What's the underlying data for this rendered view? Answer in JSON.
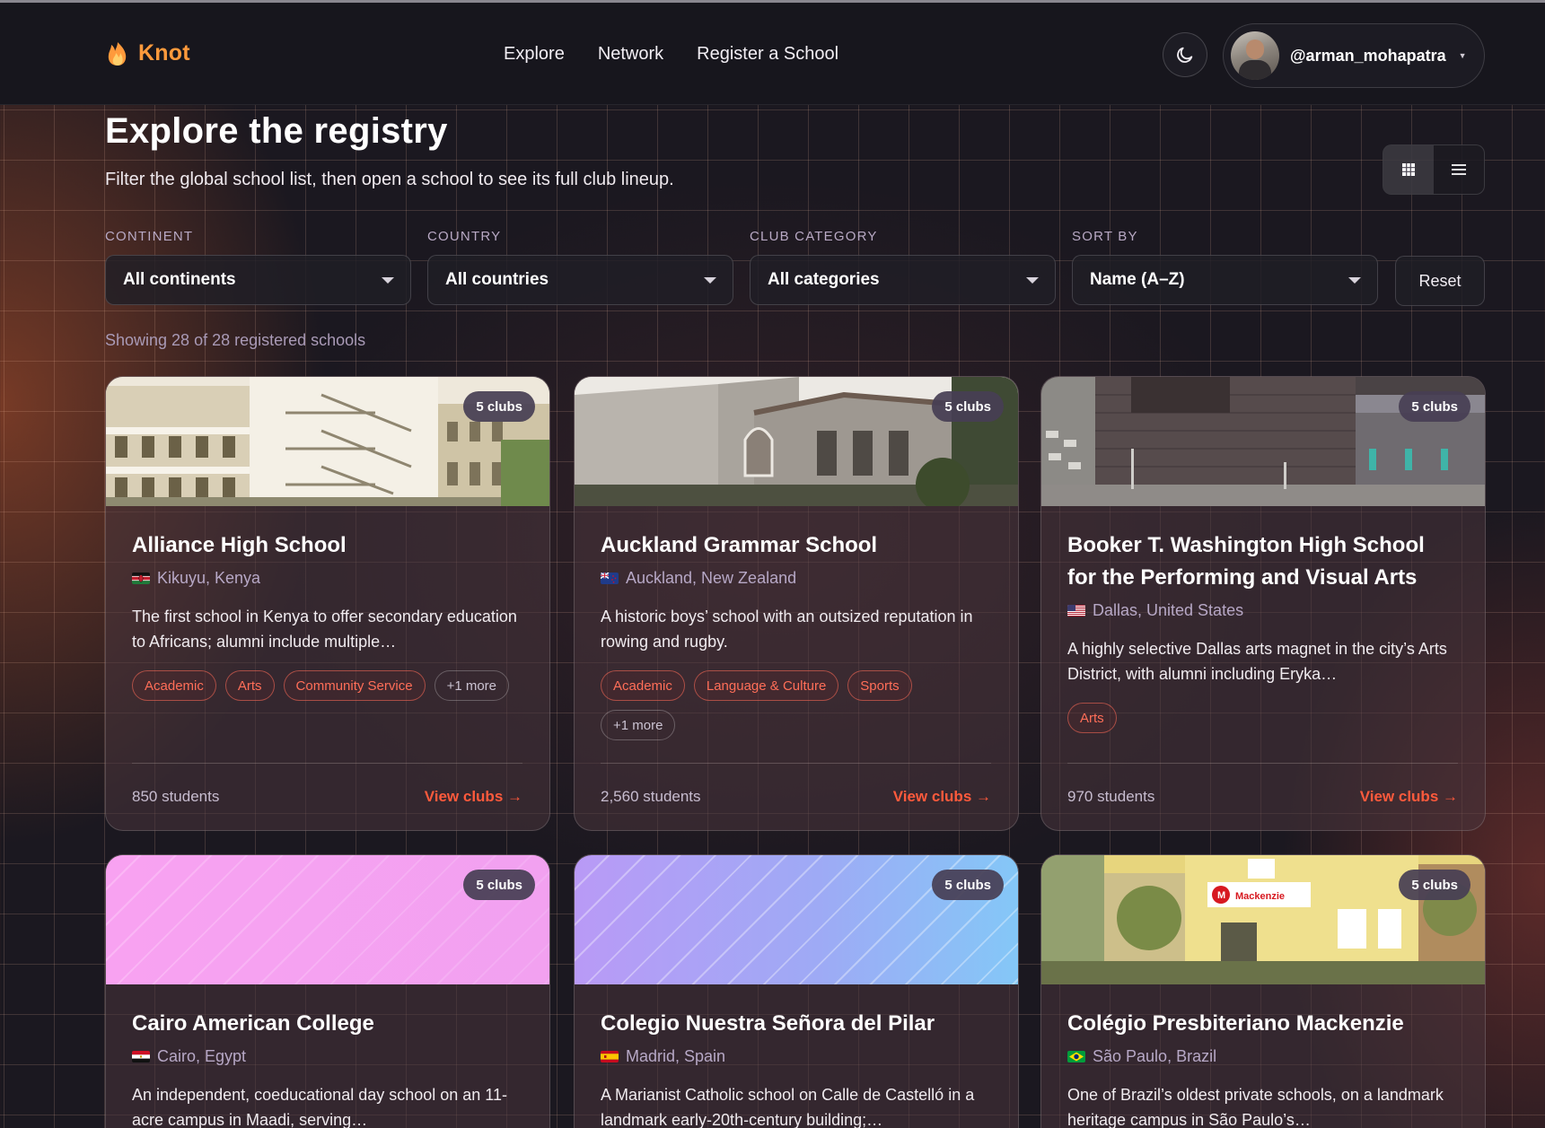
{
  "brand": {
    "name": "Knot"
  },
  "nav": {
    "items": [
      "Explore",
      "Network",
      "Register a School"
    ]
  },
  "user": {
    "handle": "@arman_mohapatra"
  },
  "page": {
    "title": "Explore the registry",
    "subtitle": "Filter the global school list, then open a school to see its full club lineup."
  },
  "filters": {
    "continent": {
      "label": "CONTINENT",
      "value": "All continents"
    },
    "country": {
      "label": "COUNTRY",
      "value": "All countries"
    },
    "category": {
      "label": "CLUB CATEGORY",
      "value": "All categories"
    },
    "sort": {
      "label": "SORT BY",
      "value": "Name (A–Z)"
    },
    "reset_label": "Reset"
  },
  "results_text": "Showing 28 of 28 registered schools",
  "view_link_label": "View clubs →",
  "schools": [
    {
      "name": "Alliance High School",
      "location": "Kikuyu, Kenya",
      "flag": "kenya",
      "clubs": "5 clubs",
      "description": "The first school in Kenya to offer secondary education to Africans; alumni include multiple…",
      "tags": [
        "Academic",
        "Arts",
        "Community Service"
      ],
      "more": "+1 more",
      "students": "850 students"
    },
    {
      "name": "Auckland Grammar School",
      "location": "Auckland, New Zealand",
      "flag": "new-zealand",
      "clubs": "5 clubs",
      "description": "A historic boys’ school with an outsized reputation in rowing and rugby.",
      "tags": [
        "Academic",
        "Language & Culture",
        "Sports"
      ],
      "more": "+1 more",
      "students": "2,560 students"
    },
    {
      "name": "Booker T. Washington High School for the Performing and Visual Arts",
      "location": "Dallas, United States",
      "flag": "united-states",
      "clubs": "5 clubs",
      "description": "A highly selective Dallas arts magnet in the city’s Arts District, with alumni including Eryka…",
      "tags": [
        "Arts"
      ],
      "students": "970 students"
    },
    {
      "name": "Cairo American College",
      "location": "Cairo, Egypt",
      "flag": "egypt",
      "clubs": "5 clubs",
      "description": "An independent, coeducational day school on an 11-acre campus in Maadi, serving…"
    },
    {
      "name": "Colegio Nuestra Señora del Pilar",
      "location": "Madrid, Spain",
      "flag": "spain",
      "clubs": "5 clubs",
      "description": "A Marianist Catholic school on Calle de Castelló in a landmark early-20th-century building;…"
    },
    {
      "name": "Colégio Presbiteriano Mackenzie",
      "location": "São Paulo, Brazil",
      "flag": "brazil",
      "clubs": "5 clubs",
      "description": "One of Brazil’s oldest private schools, on a landmark heritage campus in São Paulo’s…",
      "sign_text": "Mackenzie"
    }
  ],
  "colors": {
    "accent": "#ff5a3c",
    "brand": "#ff9a3c",
    "tag": "#ff6e58"
  }
}
